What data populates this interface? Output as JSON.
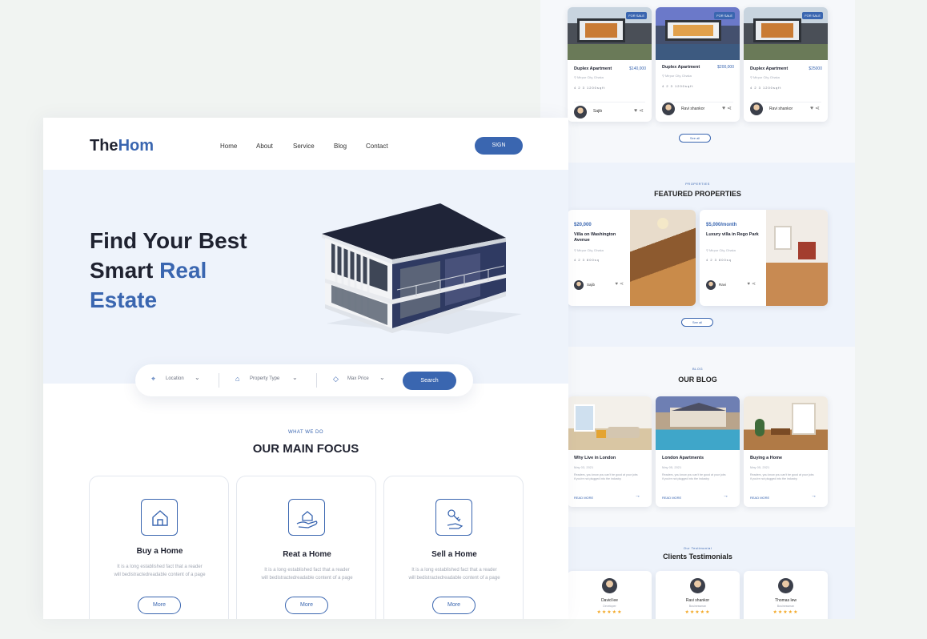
{
  "brand": {
    "name_part1": "The",
    "name_part2": "Hom",
    "accent_color": "#3a66b0"
  },
  "nav": {
    "items": [
      "Home",
      "About",
      "Service",
      "Blog",
      "Contact"
    ],
    "active": "Home",
    "sign_label": "SIGN"
  },
  "hero": {
    "line1": "Find Your Best",
    "line2_plain": "Smart",
    "line2_accent": "Real",
    "line3_accent": "Estate"
  },
  "search": {
    "location": "Location",
    "property_type": "Property Type",
    "max_price": "Max Price",
    "button": "Search"
  },
  "focus": {
    "subtitle": "WHAT WE DO",
    "title": "OUR MAIN FOCUS",
    "cards": [
      {
        "name": "Buy a Home",
        "desc": "It is a long established fact that a reader will bedistractedreadable content of a page",
        "button": "More",
        "icon": "house-icon"
      },
      {
        "name": "Reat a Home",
        "desc": "It is a long established fact that a reader will bedistractedreadable content of a page",
        "button": "More",
        "icon": "hand-house-icon"
      },
      {
        "name": "Sell a Home",
        "desc": "It is a long established fact that a reader will bedistractedreadable content of a page",
        "button": "More",
        "icon": "key-hand-icon"
      }
    ]
  },
  "listings": {
    "cards": [
      {
        "title": "Duplex Apartment",
        "price": "$140,000",
        "location": "Mirpur City, Dhaka",
        "tag": "FOR SALE",
        "features": "4  2  3  1200sqft",
        "agent": "Sajib"
      },
      {
        "title": "Duplex Apartment",
        "price": "$200,000",
        "location": "Mirpur City, Dhaka",
        "tag": "FOR SALE",
        "features": "4  2  3  1200sqft",
        "agent": "Ravi shankor"
      },
      {
        "title": "Duplex Apartment",
        "price": "$25000",
        "location": "Mirpur City, Dhaka",
        "tag": "FOR SALE",
        "features": "4  2  3  1200sqft",
        "agent": "Ravi shankor"
      }
    ],
    "see_all": "See all"
  },
  "featured": {
    "subtitle": "PROPERTIES",
    "title": "FEATURED PROPERTIES",
    "cards": [
      {
        "price": "$20,000",
        "title": "Villa on Washington Avenue",
        "location": "Mirpur City, Dhaka",
        "features": "4  2  3  800sq",
        "agent": "Sajib"
      },
      {
        "price": "$5,000/month",
        "title": "Luxury villa in Rego Park",
        "location": "Mirpur City, Dhaka",
        "features": "4  2  3  800sq",
        "agent": "Ravi"
      }
    ],
    "see_all": "See all"
  },
  "blog": {
    "subtitle": "BLOG",
    "title": "OUR BLOG",
    "cards": [
      {
        "title": "Why Live in London",
        "date": "May 03, 2021",
        "text": "Readers, you know you can't be good at your jobs if you're not plugged into the industry.",
        "read": "READ MORE"
      },
      {
        "title": "London Apartments",
        "date": "May 05, 2021",
        "text": "Readers, you know you can't be good at your jobs if you're not plugged into the industry.",
        "read": "READ MORE"
      },
      {
        "title": "Buying a Home",
        "date": "May 05, 2021",
        "text": "Readers, you know you can't be good at your jobs if you're not plugged into the industry.",
        "read": "READ MORE"
      }
    ]
  },
  "testimonials": {
    "subtitle": "Our Testimonial",
    "title": "Clients Testimonials",
    "cards": [
      {
        "name": "David lee",
        "role": "Developer",
        "stars": "★★★★★"
      },
      {
        "name": "Ravi shankor",
        "role": "Businessman",
        "stars": "★★★★★"
      },
      {
        "name": "Thomas lew",
        "role": "Businessman",
        "stars": "★★★★★"
      }
    ]
  }
}
